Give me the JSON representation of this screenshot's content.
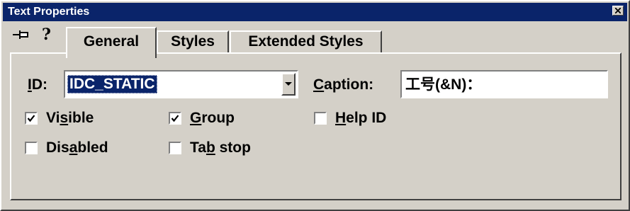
{
  "window": {
    "title": "Text Properties",
    "close_icon": "close-icon"
  },
  "toolbar": {
    "pin_icon": "pushpin-icon",
    "help_icon": "help-icon"
  },
  "tabs": [
    {
      "label": "General",
      "active": true
    },
    {
      "label": "Styles",
      "active": false
    },
    {
      "label": "Extended Styles",
      "active": false
    }
  ],
  "general": {
    "id_label": {
      "before": "",
      "mnemonic": "I",
      "after": "D:"
    },
    "id_value": "IDC_STATIC",
    "caption_label": {
      "before": "",
      "mnemonic": "C",
      "after": "aption:"
    },
    "caption_value": "工号(&N)：",
    "checkboxes": [
      {
        "before": "Vi",
        "mnemonic": "s",
        "after": "ible",
        "checked": true
      },
      {
        "before": "",
        "mnemonic": "G",
        "after": "roup",
        "checked": true
      },
      {
        "before": "",
        "mnemonic": "H",
        "after": "elp ID",
        "checked": false
      },
      {
        "before": "Dis",
        "mnemonic": "a",
        "after": "bled",
        "checked": false
      },
      {
        "before": "Ta",
        "mnemonic": "b",
        "after": " stop",
        "checked": false
      }
    ]
  }
}
